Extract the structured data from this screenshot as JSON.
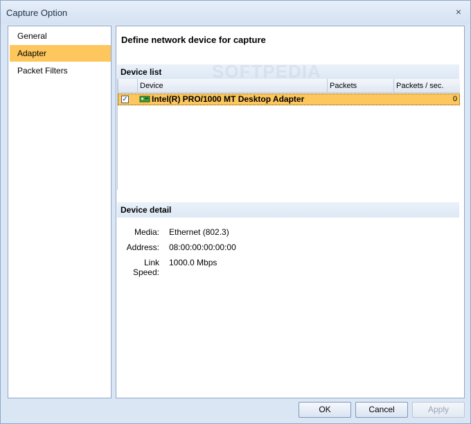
{
  "window": {
    "title": "Capture Option",
    "close_glyph": "×"
  },
  "nav": {
    "items": [
      {
        "label": "General"
      },
      {
        "label": "Adapter",
        "active": true
      },
      {
        "label": "Packet Filters"
      }
    ]
  },
  "main": {
    "title": "Define network device for capture",
    "watermark": "SOFTPEDIA",
    "device_list": {
      "section_label": "Device list",
      "columns": [
        "Device",
        "Packets",
        "Packets / sec."
      ],
      "rows": [
        {
          "checked": true,
          "check_glyph": "✓",
          "icon": "network-card-icon",
          "device": "Intel(R) PRO/1000 MT Desktop Adapter",
          "packets": "",
          "packets_per_sec": "0"
        }
      ]
    },
    "device_detail": {
      "section_label": "Device detail",
      "media_label": "Media:",
      "media_value": "Ethernet (802.3)",
      "address_label": "Address:",
      "address_value": "08:00:00:00:00:00",
      "link_speed_label": "Link Speed:",
      "link_speed_value": "1000.0 Mbps"
    }
  },
  "buttons": {
    "ok": "OK",
    "cancel": "Cancel",
    "apply": "Apply"
  },
  "colors": {
    "selection": "#fdc75e",
    "window_bg": "#dbe6f4",
    "border": "#8ea6c8"
  }
}
